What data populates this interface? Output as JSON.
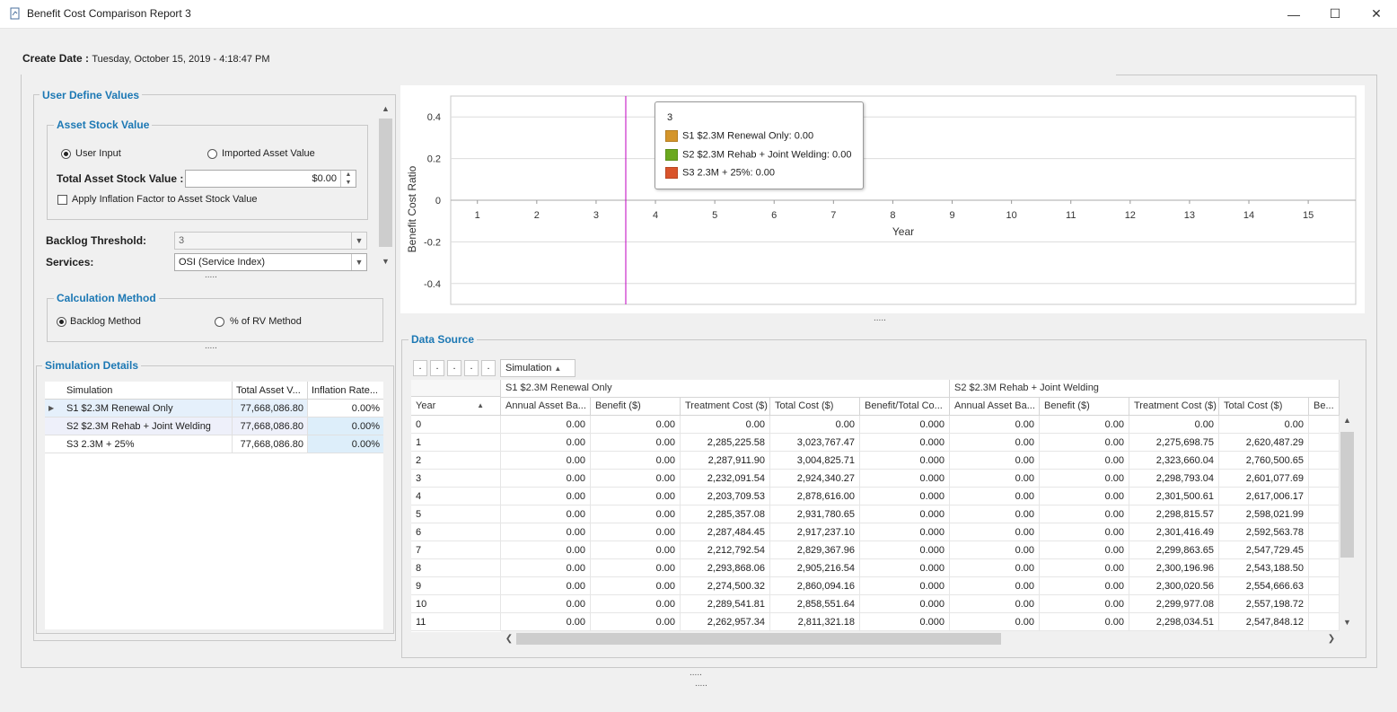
{
  "window": {
    "title": "Benefit Cost Comparison Report 3",
    "minimize": "—",
    "maximize": "☐",
    "close": "✕"
  },
  "header": {
    "create_date_label": "Create Date :",
    "create_date_value": "Tuesday, October 15, 2019 - 4:18:47 PM"
  },
  "user_define": {
    "title": "User Define Values",
    "asset_stock": {
      "title": "Asset Stock Value",
      "option_user_input": "User Input",
      "option_imported": "Imported Asset Value",
      "selected": "User Input",
      "total_label": "Total Asset Stock Value :",
      "total_value": "$0.00",
      "inflation_label": "Apply Inflation Factor to Asset Stock Value",
      "inflation_checked": false
    },
    "backlog_label": "Backlog Threshold:",
    "backlog_value": "3",
    "services_label": "Services:",
    "services_value": "OSI (Service Index)",
    "calc": {
      "title": "Calculation Method",
      "option_backlog": "Backlog Method",
      "option_rv": "% of RV Method",
      "selected": "Backlog Method"
    }
  },
  "sim_details": {
    "title": "Simulation Details",
    "columns": [
      "Simulation",
      "Total Asset V...",
      "Inflation Rate..."
    ],
    "rows": [
      {
        "name": "S1 $2.3M Renewal Only",
        "total": "77,668,086.80",
        "rate": "0.00%"
      },
      {
        "name": "S2 $2.3M Rehab + Joint Welding",
        "total": "77,668,086.80",
        "rate": "0.00%"
      },
      {
        "name": "S3 2.3M + 25%",
        "total": "77,668,086.80",
        "rate": "0.00%"
      }
    ]
  },
  "chart_data": {
    "type": "line",
    "xlabel": "Year",
    "ylabel": "Benefit Cost Ratio",
    "x": [
      1,
      2,
      3,
      4,
      5,
      6,
      7,
      8,
      9,
      10,
      11,
      12,
      13,
      14,
      15
    ],
    "yticks": [
      "0.4",
      "0.2",
      "0",
      "-0.2",
      "-0.4"
    ],
    "ylim": [
      -0.5,
      0.5
    ],
    "grid": true,
    "series": [
      {
        "name": "S1 $2.3M Renewal Only",
        "color": "#d4952a",
        "values": [
          0,
          0,
          0,
          0,
          0,
          0,
          0,
          0,
          0,
          0,
          0,
          0,
          0,
          0,
          0
        ]
      },
      {
        "name": "S2 $2.3M Rehab + Joint Welding",
        "color": "#6aa81e",
        "values": [
          0,
          0,
          0,
          0,
          0,
          0,
          0,
          0,
          0,
          0,
          0,
          0,
          0,
          0,
          0
        ]
      },
      {
        "name": "S3 2.3M + 25%",
        "color": "#d9542b",
        "values": [
          0,
          0,
          0,
          0,
          0,
          0,
          0,
          0,
          0,
          0,
          0,
          0,
          0,
          0,
          0
        ]
      }
    ],
    "crosshair_x": 3.5,
    "tooltip": {
      "title": "3",
      "entries": [
        "S1 $2.3M Renewal Only: 0.00",
        "S2 $2.3M Rehab + Joint Welding: 0.00",
        "S3 2.3M + 25%: 0.00"
      ]
    }
  },
  "data_source": {
    "title": "Data Source",
    "group_field": "Simulation",
    "year_header": "Year",
    "band_s1": "S1 $2.3M Renewal Only",
    "band_s2": "S2 $2.3M Rehab + Joint Welding",
    "columns_s1": [
      "Annual Asset Ba...",
      "Benefit ($)",
      "Treatment Cost ($)",
      "Total Cost ($)",
      "Benefit/Total Co..."
    ],
    "columns_s2": [
      "Annual Asset Ba...",
      "Benefit ($)",
      "Treatment Cost ($)",
      "Total Cost ($)",
      "Be..."
    ],
    "rows": [
      {
        "year": "0",
        "s1": [
          "0.00",
          "0.00",
          "0.00",
          "0.00",
          "0.000"
        ],
        "s2": [
          "0.00",
          "0.00",
          "0.00",
          "0.00"
        ]
      },
      {
        "year": "1",
        "s1": [
          "0.00",
          "0.00",
          "2,285,225.58",
          "3,023,767.47",
          "0.000"
        ],
        "s2": [
          "0.00",
          "0.00",
          "2,275,698.75",
          "2,620,487.29"
        ]
      },
      {
        "year": "2",
        "s1": [
          "0.00",
          "0.00",
          "2,287,911.90",
          "3,004,825.71",
          "0.000"
        ],
        "s2": [
          "0.00",
          "0.00",
          "2,323,660.04",
          "2,760,500.65"
        ]
      },
      {
        "year": "3",
        "s1": [
          "0.00",
          "0.00",
          "2,232,091.54",
          "2,924,340.27",
          "0.000"
        ],
        "s2": [
          "0.00",
          "0.00",
          "2,298,793.04",
          "2,601,077.69"
        ]
      },
      {
        "year": "4",
        "s1": [
          "0.00",
          "0.00",
          "2,203,709.53",
          "2,878,616.00",
          "0.000"
        ],
        "s2": [
          "0.00",
          "0.00",
          "2,301,500.61",
          "2,617,006.17"
        ]
      },
      {
        "year": "5",
        "s1": [
          "0.00",
          "0.00",
          "2,285,357.08",
          "2,931,780.65",
          "0.000"
        ],
        "s2": [
          "0.00",
          "0.00",
          "2,298,815.57",
          "2,598,021.99"
        ]
      },
      {
        "year": "6",
        "s1": [
          "0.00",
          "0.00",
          "2,287,484.45",
          "2,917,237.10",
          "0.000"
        ],
        "s2": [
          "0.00",
          "0.00",
          "2,301,416.49",
          "2,592,563.78"
        ]
      },
      {
        "year": "7",
        "s1": [
          "0.00",
          "0.00",
          "2,212,792.54",
          "2,829,367.96",
          "0.000"
        ],
        "s2": [
          "0.00",
          "0.00",
          "2,299,863.65",
          "2,547,729.45"
        ]
      },
      {
        "year": "8",
        "s1": [
          "0.00",
          "0.00",
          "2,293,868.06",
          "2,905,216.54",
          "0.000"
        ],
        "s2": [
          "0.00",
          "0.00",
          "2,300,196.96",
          "2,543,188.50"
        ]
      },
      {
        "year": "9",
        "s1": [
          "0.00",
          "0.00",
          "2,274,500.32",
          "2,860,094.16",
          "0.000"
        ],
        "s2": [
          "0.00",
          "0.00",
          "2,300,020.56",
          "2,554,666.63"
        ]
      },
      {
        "year": "10",
        "s1": [
          "0.00",
          "0.00",
          "2,289,541.81",
          "2,858,551.64",
          "0.000"
        ],
        "s2": [
          "0.00",
          "0.00",
          "2,299,977.08",
          "2,557,198.72"
        ]
      },
      {
        "year": "11",
        "s1": [
          "0.00",
          "0.00",
          "2,262,957.34",
          "2,811,321.18",
          "0.000"
        ],
        "s2": [
          "0.00",
          "0.00",
          "2,298,034.51",
          "2,547,848.12"
        ]
      }
    ]
  },
  "splitter": "....."
}
